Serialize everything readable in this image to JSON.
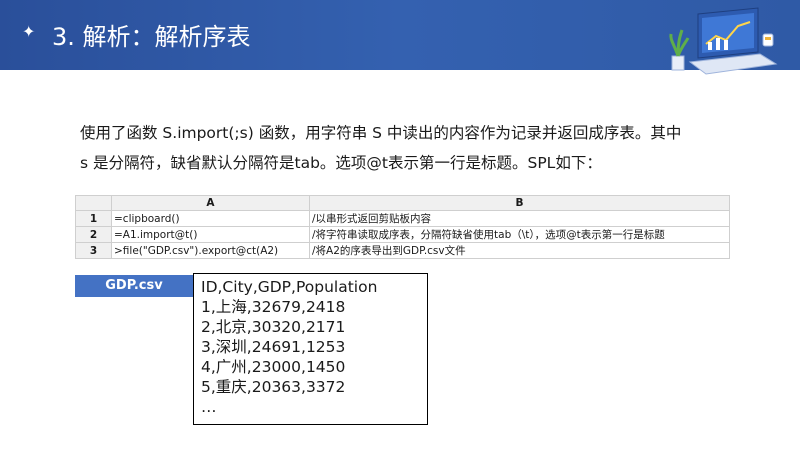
{
  "header": {
    "star": "✦",
    "title": "3. 解析：解析序表"
  },
  "description": {
    "line1": "使用了函数 S.import(;s) 函数，用字符串 S 中读出的内容作为记录并返回成序表。其中",
    "line2": "s 是分隔符，缺省默认分隔符是tab。选项@t表示第一行是标题。SPL如下："
  },
  "spl_table": {
    "columns": [
      "",
      "A",
      "B"
    ],
    "rows": [
      {
        "num": "1",
        "a": "=clipboard()",
        "b": "/以串形式返回剪贴板内容"
      },
      {
        "num": "2",
        "a": "=A1.import@t()",
        "b": "/将字符串读取成序表，分隔符缺省使用tab（\\t），选项@t表示第一行是标题"
      },
      {
        "num": "3",
        "a": ">file(\"GDP.csv\").export@ct(A2)",
        "b": "/将A2的序表导出到GDP.csv文件"
      }
    ]
  },
  "file": {
    "label": "GDP.csv",
    "lines": [
      "ID,City,GDP,Population",
      "1,上海,32679,2418",
      "2,北京,30320,2171",
      "3,深圳,24691,1253",
      "4,广州,23000,1450",
      "5,重庆,20363,3372",
      "…"
    ]
  }
}
